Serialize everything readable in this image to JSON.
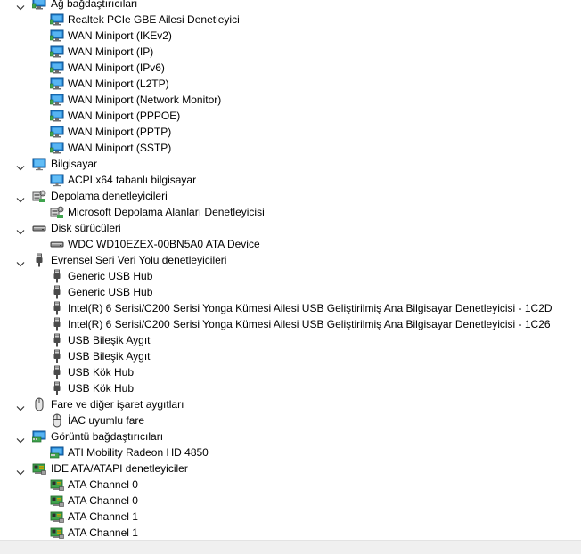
{
  "categories": [
    {
      "label": "Ağ bağdaştırıcıları",
      "icon": "network-adapter-icon",
      "children": [
        "Realtek PCIe GBE Ailesi Denetleyici",
        "WAN Miniport (IKEv2)",
        "WAN Miniport (IP)",
        "WAN Miniport (IPv6)",
        "WAN Miniport (L2TP)",
        "WAN Miniport (Network Monitor)",
        "WAN Miniport (PPPOE)",
        "WAN Miniport (PPTP)",
        "WAN Miniport (SSTP)"
      ],
      "child_icon": "network-adapter-icon"
    },
    {
      "label": "Bilgisayar",
      "icon": "computer-icon",
      "children": [
        "ACPI x64 tabanlı bilgisayar"
      ],
      "child_icon": "computer-icon"
    },
    {
      "label": "Depolama denetleyicileri",
      "icon": "storage-controller-icon",
      "children": [
        "Microsoft Depolama Alanları Denetleyicisi"
      ],
      "child_icon": "storage-controller-icon"
    },
    {
      "label": "Disk sürücüleri",
      "icon": "disk-drive-icon",
      "children": [
        "WDC WD10EZEX-00BN5A0 ATA Device"
      ],
      "child_icon": "disk-drive-icon"
    },
    {
      "label": "Evrensel Seri Veri Yolu denetleyicileri",
      "icon": "usb-icon",
      "children": [
        "Generic USB Hub",
        "Generic USB Hub",
        "Intel(R) 6 Serisi/C200 Serisi Yonga Kümesi Ailesi USB Geliştirilmiş Ana Bilgisayar Denetleyicisi - 1C2D",
        "Intel(R) 6 Serisi/C200 Serisi Yonga Kümesi Ailesi USB Geliştirilmiş Ana Bilgisayar Denetleyicisi - 1C26",
        "USB Bileşik Aygıt",
        "USB Bileşik Aygıt",
        "USB Kök Hub",
        "USB Kök Hub"
      ],
      "child_icon": "usb-icon"
    },
    {
      "label": "Fare ve diğer işaret aygıtları",
      "icon": "mouse-icon",
      "children": [
        "İAC uyumlu fare"
      ],
      "child_icon": "mouse-icon"
    },
    {
      "label": "Görüntü bağdaştırıcıları",
      "icon": "display-adapter-icon",
      "children": [
        "ATI Mobility Radeon HD 4850"
      ],
      "child_icon": "display-adapter-icon"
    },
    {
      "label": "IDE ATA/ATAPI denetleyiciler",
      "icon": "ide-controller-icon",
      "children": [
        "ATA Channel 0",
        "ATA Channel 0",
        "ATA Channel 1",
        "ATA Channel 1"
      ],
      "child_icon": "ide-controller-icon"
    }
  ]
}
